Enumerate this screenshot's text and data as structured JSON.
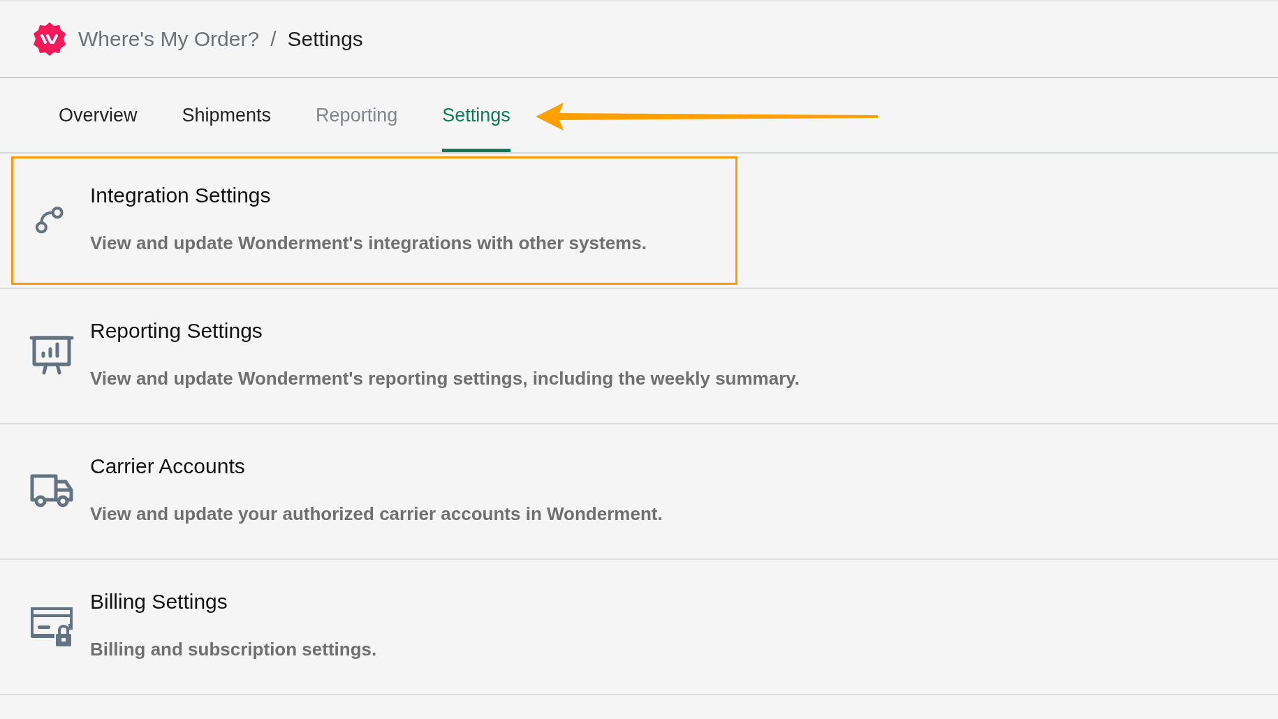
{
  "breadcrumb": {
    "app": "Where's My Order?",
    "separator": "/",
    "current": "Settings"
  },
  "tabs": [
    {
      "label": "Overview",
      "selected": false,
      "disabled": false,
      "pointed": false
    },
    {
      "label": "Shipments",
      "selected": false,
      "disabled": false,
      "pointed": false
    },
    {
      "label": "Reporting",
      "selected": false,
      "disabled": true,
      "pointed": false
    },
    {
      "label": "Settings",
      "selected": true,
      "disabled": false,
      "pointed": true
    }
  ],
  "settings": [
    {
      "kind": "integration",
      "title": "Integration Settings",
      "description": "View and update Wonderment's integrations with other systems.",
      "highlighted": true
    },
    {
      "kind": "reporting",
      "title": "Reporting Settings",
      "description": "View and update Wonderment's reporting settings, including the weekly summary.",
      "highlighted": false
    },
    {
      "kind": "carrier",
      "title": "Carrier Accounts",
      "description": "View and update your authorized carrier accounts in Wonderment.",
      "highlighted": false
    },
    {
      "kind": "billing",
      "title": "Billing Settings",
      "description": "Billing and subscription settings.",
      "highlighted": false
    }
  ]
}
